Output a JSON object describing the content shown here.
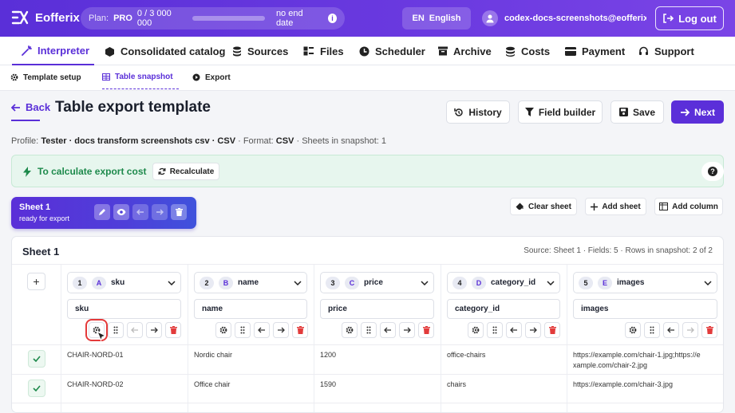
{
  "header": {
    "app_name": "Eofferix",
    "plan_label": "Plan:",
    "plan_name": "PRO",
    "plan_usage": "0 / 3 000 000",
    "plan_expiry": "no end date",
    "lang_code": "EN",
    "lang_name": "English",
    "user_email": "codex-docs-screenshots@eofferix",
    "logout_label": "Log out"
  },
  "nav": {
    "items": [
      {
        "label": "Interpreter",
        "icon": "wand-icon"
      },
      {
        "label": "Consolidated catalog",
        "icon": "box-icon"
      },
      {
        "label": "Sources",
        "icon": "database-icon"
      },
      {
        "label": "Files",
        "icon": "files-icon"
      },
      {
        "label": "Scheduler",
        "icon": "clock-icon"
      },
      {
        "label": "Archive",
        "icon": "archive-icon"
      },
      {
        "label": "Costs",
        "icon": "coins-icon"
      },
      {
        "label": "Payment",
        "icon": "card-icon"
      },
      {
        "label": "Support",
        "icon": "headset-icon"
      }
    ]
  },
  "subnav": {
    "items": [
      {
        "label": "Template setup",
        "icon": "gear-icon"
      },
      {
        "label": "Table snapshot",
        "icon": "table-icon"
      },
      {
        "label": "Export",
        "icon": "play-icon"
      }
    ]
  },
  "page": {
    "back_label": "Back",
    "title": "Table export template",
    "history_label": "History",
    "field_builder_label": "Field builder",
    "save_label": "Save",
    "next_label": "Next"
  },
  "profile": {
    "prefix": "Profile:",
    "name": "Tester · docs transform screenshots csv · CSV",
    "format_prefix": "· Format:",
    "format": "CSV",
    "sheets_text": "· Sheets in snapshot: 1"
  },
  "notice": {
    "text": "To calculate export cost",
    "recalc_label": "Recalculate"
  },
  "sheet_card": {
    "name": "Sheet 1",
    "status": "ready for export"
  },
  "sheet_actions": {
    "clear_label": "Clear sheet",
    "add_sheet_label": "Add sheet",
    "add_column_label": "Add column"
  },
  "panel": {
    "title": "Sheet 1",
    "source_info": "Source: Sheet 1 · Fields: 5 · Rows in snapshot: 2 of 2"
  },
  "columns": [
    {
      "num": "1",
      "letter": "A",
      "name": "sku",
      "field": "sku"
    },
    {
      "num": "2",
      "letter": "B",
      "name": "name",
      "field": "name"
    },
    {
      "num": "3",
      "letter": "C",
      "name": "price",
      "field": "price"
    },
    {
      "num": "4",
      "letter": "D",
      "name": "category_id",
      "field": "category_id"
    },
    {
      "num": "5",
      "letter": "E",
      "name": "images",
      "field": "images"
    }
  ],
  "rows": [
    [
      "CHAIR-NORD-01",
      "Nordic chair",
      "1200",
      "office-chairs",
      "https://example.com/chair-1.jpg;https://example.com/chair-2.jpg"
    ],
    [
      "CHAIR-NORD-02",
      "Office chair",
      "1590",
      "chairs",
      "https://example.com/chair-3.jpg"
    ]
  ],
  "colors": {
    "accent": "#5a2fd8",
    "success": "#1e8a4c",
    "danger": "#e23b3b"
  }
}
